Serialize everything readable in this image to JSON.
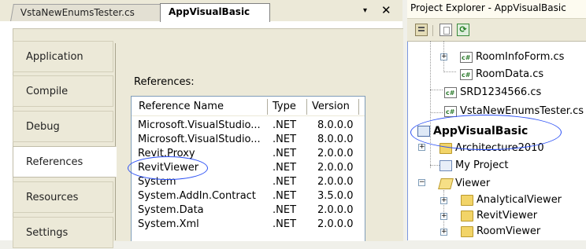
{
  "tabs": [
    {
      "label": "VstaNewEnumsTester.cs",
      "active": false
    },
    {
      "label": "AppVisualBasic",
      "active": true
    }
  ],
  "tab_controls": {
    "menu": "▾",
    "close": "✕"
  },
  "side_tabs": [
    {
      "label": "Application",
      "active": false
    },
    {
      "label": "Compile",
      "active": false
    },
    {
      "label": "Debug",
      "active": false
    },
    {
      "label": "References",
      "active": true
    },
    {
      "label": "Resources",
      "active": false
    },
    {
      "label": "Settings",
      "active": false
    }
  ],
  "references": {
    "label": "References:",
    "columns": [
      "Reference Name",
      "Type",
      "Version"
    ],
    "rows": [
      {
        "name": "Microsoft.VisualStudio...",
        "type": ".NET",
        "version": "8.0.0.0"
      },
      {
        "name": "Microsoft.VisualStudio...",
        "type": ".NET",
        "version": "8.0.0.0"
      },
      {
        "name": "Revit.Proxy",
        "type": ".NET",
        "version": "2.0.0.0"
      },
      {
        "name": "RevitViewer",
        "type": ".NET",
        "version": "2.0.0.0"
      },
      {
        "name": "System",
        "type": ".NET",
        "version": "2.0.0.0"
      },
      {
        "name": "System.AddIn.Contract",
        "type": ".NET",
        "version": "3.5.0.0"
      },
      {
        "name": "System.Data",
        "type": ".NET",
        "version": "2.0.0.0"
      },
      {
        "name": "System.Xml",
        "type": ".NET",
        "version": "2.0.0.0"
      }
    ]
  },
  "project_explorer": {
    "title": "Project Explorer - AppVisualBasic",
    "toolbar": [
      {
        "name": "properties-icon"
      },
      {
        "name": "show-all-files-icon"
      },
      {
        "name": "refresh-icon",
        "glyph": "⟳"
      }
    ],
    "items": [
      {
        "label": "RoomInfoForm.cs",
        "icon": "cs-file-icon"
      },
      {
        "label": "RoomData.cs",
        "icon": "cs-file-icon"
      },
      {
        "label": "SRD1234566.cs",
        "icon": "cs-file-icon"
      },
      {
        "label": "VstaNewEnumsTester.cs",
        "icon": "cs-file-icon"
      },
      {
        "label": "AppVisualBasic",
        "icon": "vb-project-icon"
      },
      {
        "label": "Architecture2010",
        "icon": "folder-icon"
      },
      {
        "label": "My Project",
        "icon": "my-project-icon"
      },
      {
        "label": "Viewer",
        "icon": "folder-open-icon"
      },
      {
        "label": "AnalyticalViewer",
        "icon": "folder-icon"
      },
      {
        "label": "RevitViewer",
        "icon": "folder-icon"
      },
      {
        "label": "RoomViewer",
        "icon": "folder-icon"
      }
    ],
    "expander_glyphs": {
      "plus": "+",
      "minus": "−"
    }
  },
  "colors": {
    "annotation_circle": "#2a4ff5",
    "panel_background": "#ece9d8",
    "list_border": "#7f9db9"
  }
}
